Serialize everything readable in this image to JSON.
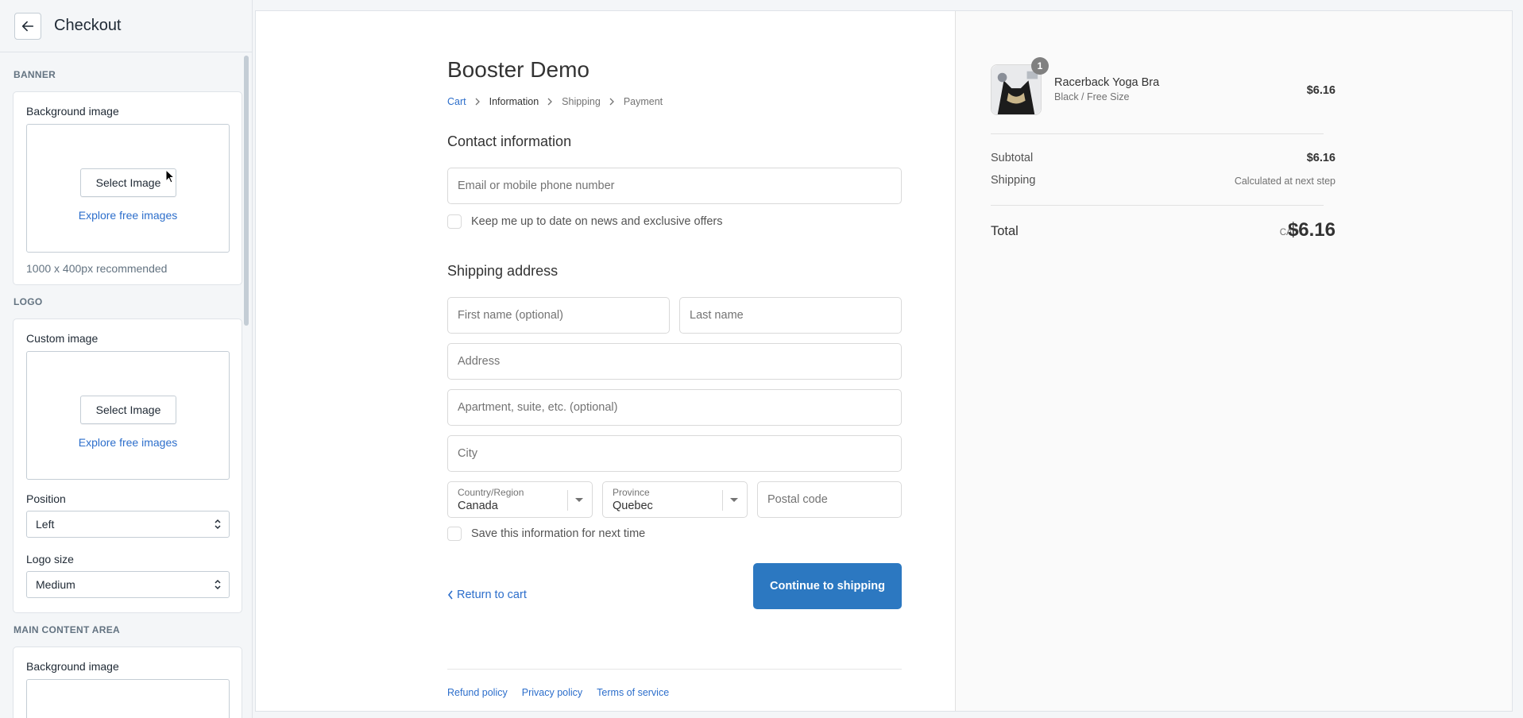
{
  "sidebar": {
    "title": "Checkout",
    "banner": {
      "section_label": "BANNER",
      "bg_label": "Background image",
      "select_button": "Select Image",
      "explore_link": "Explore free images",
      "hint": "1000 x 400px recommended"
    },
    "logo": {
      "section_label": "LOGO",
      "custom_label": "Custom image",
      "select_button": "Select Image",
      "explore_link": "Explore free images",
      "position_label": "Position",
      "position_value": "Left",
      "size_label": "Logo size",
      "size_value": "Medium"
    },
    "main_content": {
      "section_label": "MAIN CONTENT AREA",
      "bg_label": "Background image"
    }
  },
  "checkout": {
    "shop_name": "Booster Demo",
    "breadcrumb": [
      "Cart",
      "Information",
      "Shipping",
      "Payment"
    ],
    "contact": {
      "title": "Contact information",
      "email_placeholder": "Email or mobile phone number",
      "news_checkbox": "Keep me up to date on news and exclusive offers"
    },
    "shipping": {
      "title": "Shipping address",
      "first_name": "First name (optional)",
      "last_name": "Last name",
      "address": "Address",
      "apartment": "Apartment, suite, etc. (optional)",
      "city": "City",
      "country_label": "Country/Region",
      "country_value": "Canada",
      "province_label": "Province",
      "province_value": "Quebec",
      "postal": "Postal code",
      "save_checkbox": "Save this information for next time"
    },
    "return_link": "Return to cart",
    "continue_button": "Continue to shipping",
    "footer": [
      "Refund policy",
      "Privacy policy",
      "Terms of service"
    ]
  },
  "summary": {
    "product": {
      "name": "Racerback Yoga Bra",
      "variant": "Black / Free Size",
      "price": "$6.16",
      "quantity": "1"
    },
    "subtotal_label": "Subtotal",
    "subtotal_value": "$6.16",
    "shipping_label": "Shipping",
    "shipping_value": "Calculated at next step",
    "total_label": "Total",
    "currency": "CAD",
    "total_value": "$6.16"
  },
  "colors": {
    "accent": "#2c78c1",
    "link": "#2c6ecb"
  }
}
